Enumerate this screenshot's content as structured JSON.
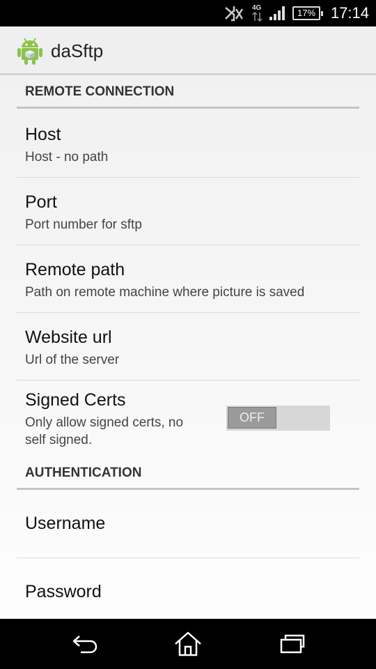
{
  "status_bar": {
    "network_label": "4G",
    "battery": "17%",
    "time": "17:14",
    "icons": [
      "signal-blocked-icon",
      "data-transfer-icon",
      "cell-signal-icon",
      "battery-icon"
    ]
  },
  "action_bar": {
    "app_icon": "android-robot-icon",
    "title": "daSftp"
  },
  "sections": {
    "remote_connection": {
      "header": "REMOTE CONNECTION",
      "items": [
        {
          "title": "Host",
          "summary": "Host - no path"
        },
        {
          "title": "Port",
          "summary": "Port number for sftp"
        },
        {
          "title": "Remote path",
          "summary": "Path on remote machine where picture is saved"
        },
        {
          "title": "Website url",
          "summary": "Url of the server"
        }
      ],
      "signed_certs": {
        "title": "Signed Certs",
        "summary_line1": "Only allow signed certs, no",
        "summary_line2": "self signed.",
        "toggle_state": "OFF"
      }
    },
    "authentication": {
      "header": "AUTHENTICATION",
      "items": [
        {
          "title": "Username"
        },
        {
          "title": "Password"
        }
      ]
    }
  },
  "nav_bar": {
    "icons": [
      "back-icon",
      "home-icon",
      "recent-apps-icon"
    ]
  }
}
